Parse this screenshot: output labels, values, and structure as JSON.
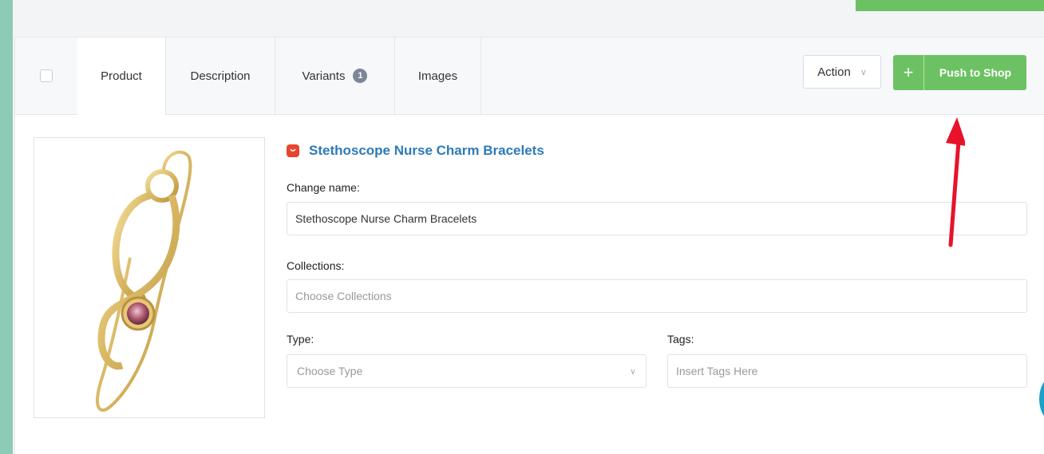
{
  "tabs": {
    "product": "Product",
    "description": "Description",
    "variants": "Variants",
    "variants_count": "1",
    "images": "Images"
  },
  "toolbar": {
    "action_label": "Action",
    "push_plus": "+",
    "push_label": "Push to Shop"
  },
  "product": {
    "title": "Stethoscope Nurse Charm Bracelets",
    "change_name_label": "Change name:",
    "name_value": "Stethoscope Nurse Charm  Bracelets",
    "collections_label": "Collections:",
    "collections_placeholder": "Choose Collections",
    "type_label": "Type:",
    "type_placeholder": "Choose Type",
    "tags_label": "Tags:",
    "tags_placeholder": "Insert Tags Here"
  },
  "colors": {
    "accent_green": "#6cc262",
    "link_blue": "#2d7ab8",
    "arrow_red": "#e8132b"
  },
  "icons": [
    "checkbox",
    "badge",
    "chevron-down-icon",
    "plus-icon",
    "shopping-bag-icon",
    "red-arrow-annotation"
  ]
}
